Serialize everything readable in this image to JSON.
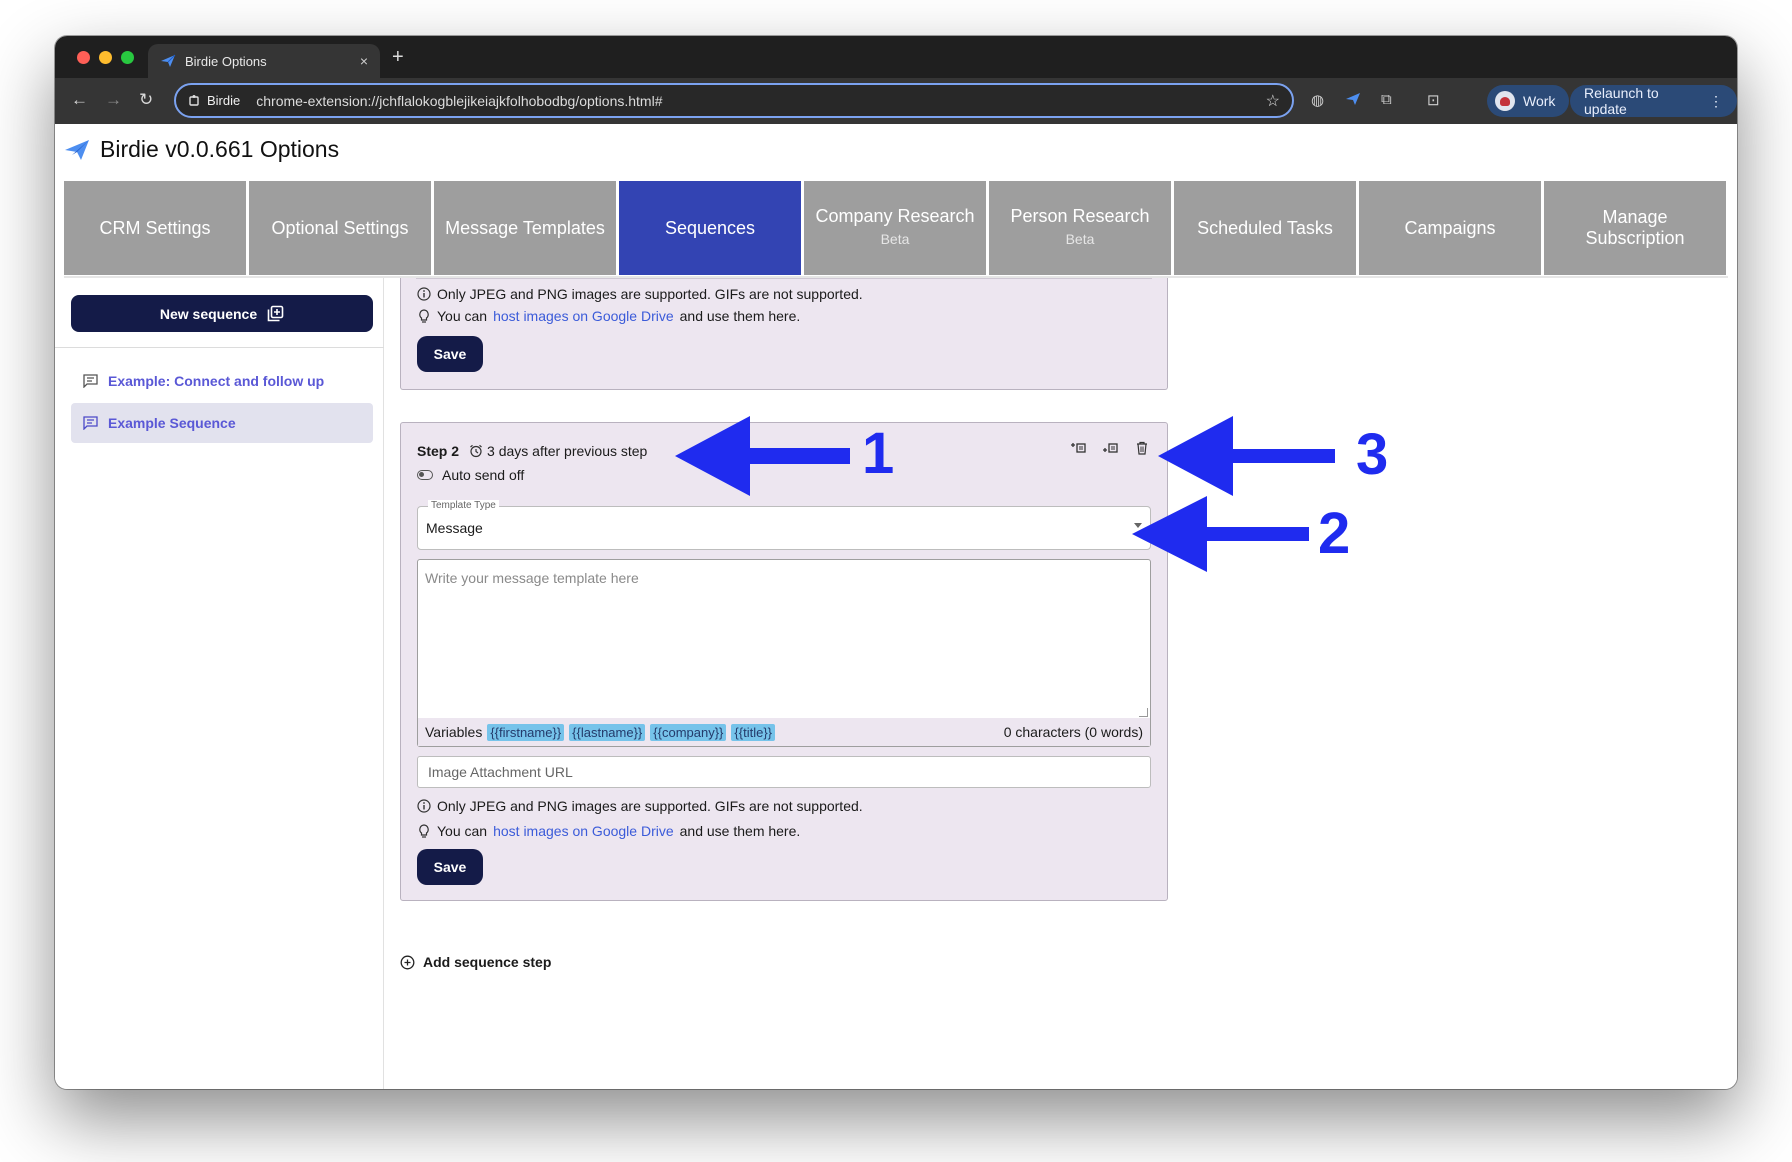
{
  "browser": {
    "tab_title": "Birdie Options",
    "tab_close": "×",
    "new_tab": "+",
    "site_chip": "Birdie",
    "url": "chrome-extension://jchflalokogblejikeiajkfolhobodbg/options.html#",
    "profile": "Work",
    "relaunch": "Relaunch to update"
  },
  "app": {
    "title": "Birdie v0.0.661 Options"
  },
  "tabs": [
    {
      "label": "CRM Settings",
      "sub": ""
    },
    {
      "label": "Optional Settings",
      "sub": ""
    },
    {
      "label": "Message Templates",
      "sub": ""
    },
    {
      "label": "Sequences",
      "sub": ""
    },
    {
      "label": "Company Research",
      "sub": "Beta"
    },
    {
      "label": "Person Research",
      "sub": "Beta"
    },
    {
      "label": "Scheduled Tasks",
      "sub": ""
    },
    {
      "label": "Campaigns",
      "sub": ""
    },
    {
      "label": "Manage Subscription",
      "sub": ""
    }
  ],
  "active_tab": "Sequences",
  "sidebar": {
    "new_sequence": "New sequence",
    "items": [
      {
        "label": "Example: Connect and follow up"
      },
      {
        "label": "Example Sequence"
      }
    ]
  },
  "step1": {
    "note_formats": "Only JPEG and PNG images are supported. GIFs are not supported.",
    "tip_prefix": "You can",
    "tip_link": "host images on Google Drive",
    "tip_suffix": "and use them here.",
    "save": "Save"
  },
  "step2": {
    "label": "Step 2",
    "timing": "3 days after previous step",
    "autosend": "Auto send off",
    "template_type_label": "Template Type",
    "template_type_value": "Message",
    "message_placeholder": "Write your message template here",
    "variables_label": "Variables",
    "variables": [
      "{{firstname}}",
      "{{lastname}}",
      "{{company}}",
      "{{title}}"
    ],
    "char_count": "0 characters (0 words)",
    "image_url_placeholder": "Image Attachment URL",
    "note_formats": "Only JPEG and PNG images are supported. GIFs are not supported.",
    "tip_prefix": "You can",
    "tip_link": "host images on Google Drive",
    "tip_suffix": "and use them here.",
    "save": "Save"
  },
  "add_step": "Add sequence step",
  "annotations": [
    "1",
    "2",
    "3"
  ],
  "colors": {
    "active_tab": "#3344b3",
    "inactive_tab": "#9e9e9e",
    "primary_button": "#141b48",
    "link": "#3b5bd9",
    "annotation": "#1f2bef"
  }
}
